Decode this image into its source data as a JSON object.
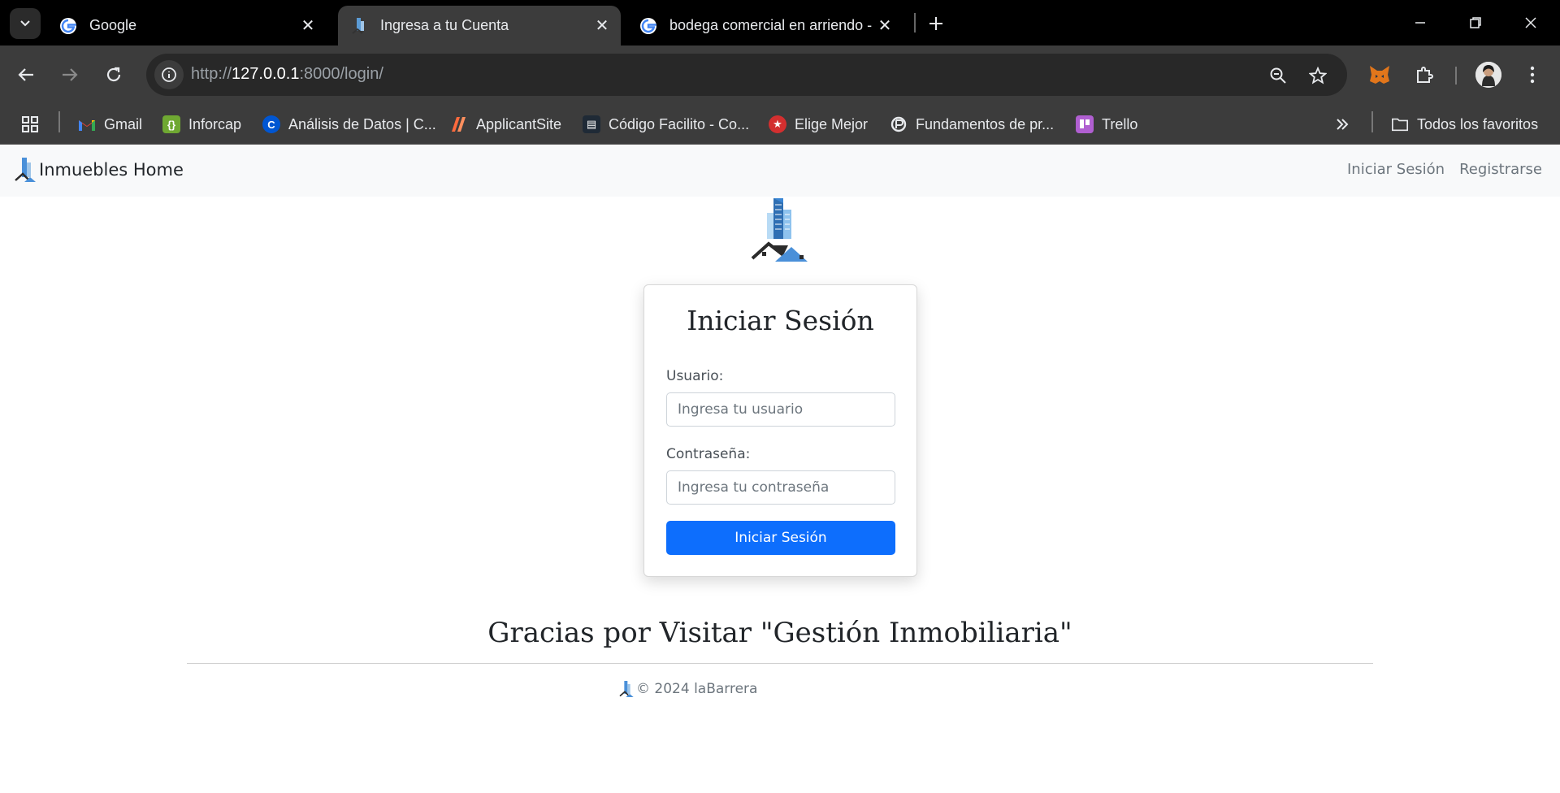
{
  "browser": {
    "tabs": [
      {
        "title": "Google",
        "active": false
      },
      {
        "title": "Ingresa a tu Cuenta",
        "active": true
      },
      {
        "title": "bodega comercial en arriendo -",
        "active": false
      }
    ],
    "url": {
      "scheme": "http://",
      "host": "127.0.0.1",
      "rest": ":8000/login/"
    },
    "bookmarks": [
      {
        "label": "Gmail",
        "icon": "gmail-icon"
      },
      {
        "label": "Inforcap",
        "icon": "inforcap-icon"
      },
      {
        "label": "Análisis de Datos | C...",
        "icon": "coursera-icon"
      },
      {
        "label": "ApplicantSite",
        "icon": "applicantsite-icon"
      },
      {
        "label": "Código Facilito - Co...",
        "icon": "codigofacilito-icon"
      },
      {
        "label": "Elige Mejor",
        "icon": "eligemejor-icon"
      },
      {
        "label": "Fundamentos de pr...",
        "icon": "fundamentos-icon"
      },
      {
        "label": "Trello",
        "icon": "trello-icon"
      }
    ],
    "all_bookmarks": "Todos los favoritos"
  },
  "site": {
    "brand": "Inmuebles Home",
    "nav": {
      "login": "Iniciar Sesión",
      "register": "Registrarse"
    }
  },
  "login": {
    "title": "Iniciar Sesión",
    "user_label": "Usuario:",
    "user_placeholder": "Ingresa tu usuario",
    "user_value": "",
    "password_label": "Contraseña:",
    "password_placeholder": "Ingresa tu contraseña",
    "password_value": "",
    "submit": "Iniciar Sesión"
  },
  "footer": {
    "thanks": "Gracias por Visitar \"Gestión Inmobiliaria\"",
    "copyright": "© 2024 laBarrera"
  },
  "colors": {
    "primary": "#0d6efd",
    "navbar_bg": "#f8f9fa",
    "chrome_dark": "#3c3c3c"
  }
}
